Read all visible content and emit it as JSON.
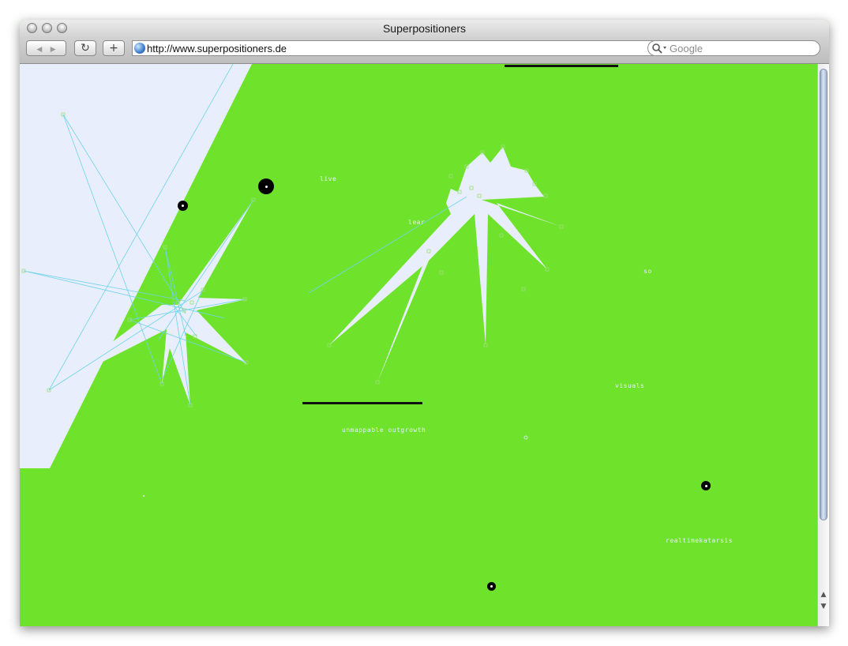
{
  "window": {
    "title": "Superpositioners",
    "toolbar": {
      "back_label": "◀",
      "forward_label": "▶",
      "reload_label": "↻",
      "add_label": "+",
      "url": "http://www.superpositioners.de",
      "search_placeholder": "Google"
    }
  },
  "page": {
    "background_color": "#6fe22c",
    "shape_color": "#e8eefc",
    "line_color": "#6fd3e8",
    "words": [
      {
        "text": "live"
      },
      {
        "text": "lear"
      },
      {
        "text": "so"
      },
      {
        "text": "visuals"
      },
      {
        "text": "unmappable outgrowth"
      },
      {
        "text": "realtimekatarsis"
      }
    ]
  },
  "icons": {
    "globe": "globe-icon",
    "search": "magnifier-icon",
    "traffic": [
      "close-button",
      "minimize-button",
      "zoom-button"
    ]
  }
}
